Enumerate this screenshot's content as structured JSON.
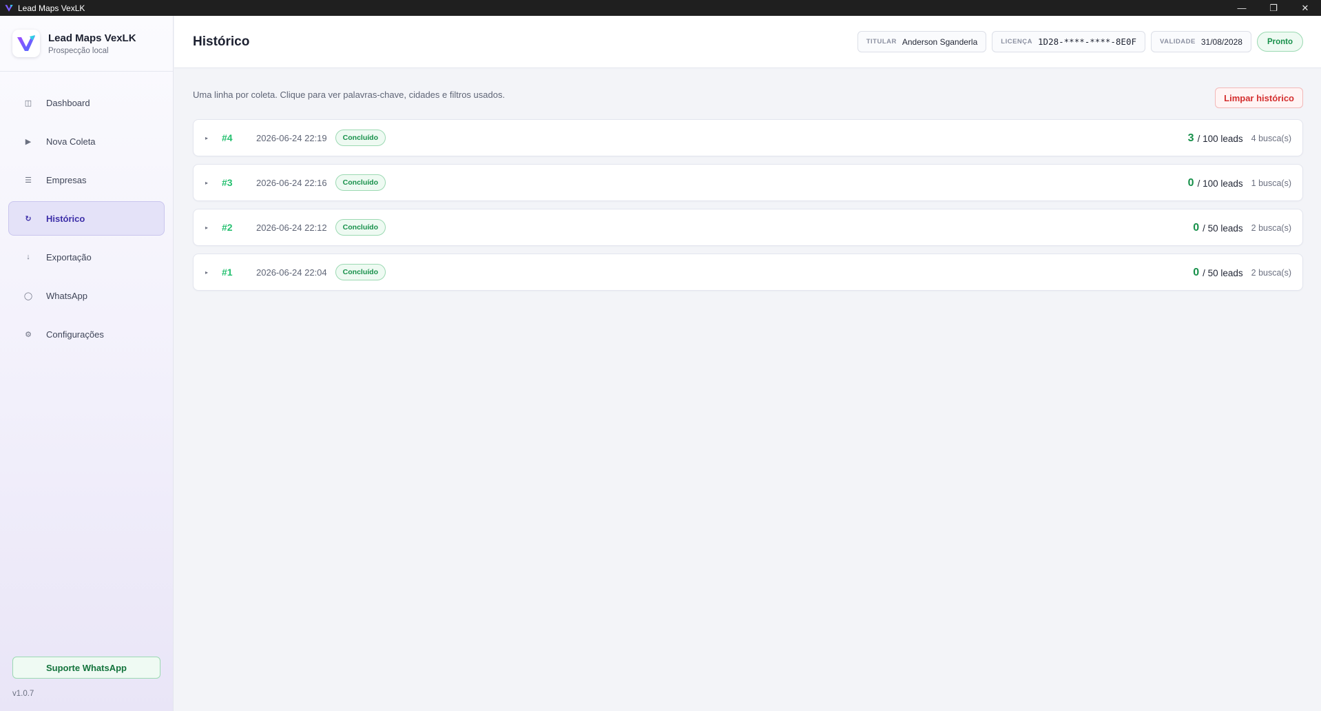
{
  "window": {
    "title": "Lead Maps VexLK",
    "controls": [
      "—",
      "❐",
      "✕"
    ]
  },
  "brand": {
    "name": "Lead Maps VexLK",
    "subtitle": "Prospecção local",
    "accent": "#5b3fe0"
  },
  "sidebar": {
    "items": [
      {
        "label": "Dashboard",
        "icon": "◫",
        "icon_name": "dashboard-icon",
        "active": false
      },
      {
        "label": "Nova Coleta",
        "icon": "▶",
        "icon_name": "play-icon",
        "active": false
      },
      {
        "label": "Empresas",
        "icon": "☰",
        "icon_name": "list-icon",
        "active": false
      },
      {
        "label": "Histórico",
        "icon": "↻",
        "icon_name": "history-icon",
        "active": true
      },
      {
        "label": "Exportação",
        "icon": "↓",
        "icon_name": "download-icon",
        "active": false
      },
      {
        "label": "WhatsApp",
        "icon": "◯",
        "icon_name": "chat-icon",
        "active": false
      },
      {
        "label": "Configurações",
        "icon": "⚙",
        "icon_name": "gear-icon",
        "active": false
      }
    ],
    "support_label": "Suporte WhatsApp",
    "version": "v1.0.7"
  },
  "header": {
    "title": "Histórico",
    "titular_label": "TITULAR",
    "titular_value": "Anderson Sganderla",
    "licenca_label": "LICENÇA",
    "licenca_value": "1D28-****-****-8E0F",
    "validade_label": "VALIDADE",
    "validade_value": "31/08/2028",
    "status": "Pronto"
  },
  "content": {
    "description": "Uma linha por coleta. Clique para ver palavras-chave, cidades e filtros usados.",
    "clear_label": "Limpar histórico",
    "rows": [
      {
        "num": "#4",
        "date": "2026-06-24 22:19",
        "status": "Concluído",
        "found": "3",
        "total": "/ 100 leads",
        "buscas": "4 busca(s)"
      },
      {
        "num": "#3",
        "date": "2026-06-24 22:16",
        "status": "Concluído",
        "found": "0",
        "total": "/ 100 leads",
        "buscas": "1 busca(s)"
      },
      {
        "num": "#2",
        "date": "2026-06-24 22:12",
        "status": "Concluído",
        "found": "0",
        "total": "/ 50 leads",
        "buscas": "2 busca(s)"
      },
      {
        "num": "#1",
        "date": "2026-06-24 22:04",
        "status": "Concluído",
        "found": "0",
        "total": "/ 50 leads",
        "buscas": "2 busca(s)"
      }
    ]
  },
  "colors": {
    "success": "#17904a",
    "danger": "#d42f2f",
    "active_nav": "#3c2ea8"
  }
}
